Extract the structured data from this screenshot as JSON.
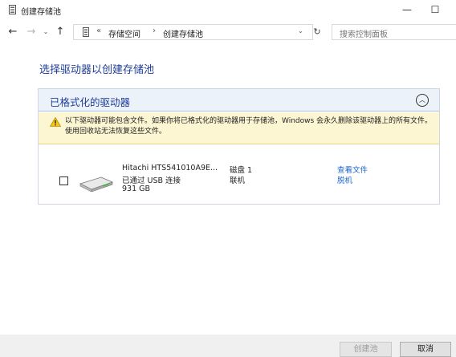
{
  "window": {
    "title": "创建存储池",
    "minimize_label": "—",
    "maximize_label": "☐"
  },
  "address": {
    "overflow": "«",
    "crumbs": [
      "存储空间",
      "创建存储池"
    ],
    "separator": "›",
    "search_placeholder": "搜索控制面板"
  },
  "main": {
    "heading": "选择驱动器以创建存储池",
    "panel_title": "已格式化的驱动器",
    "warning_text": "以下驱动器可能包含文件。如果你将已格式化的驱动器用于存储池，Windows 会永久删除该驱动器上的所有文件。使用回收站无法恢复这些文件。",
    "drives": [
      {
        "name": "Hitachi HTS541010A9E...",
        "connection": "已通过 USB 连接",
        "size": "931 GB",
        "disk": "磁盘 1",
        "state": "联机",
        "link_view": "查看文件",
        "link_offline": "脱机",
        "checked": false
      }
    ]
  },
  "footer": {
    "create_label": "创建池",
    "cancel_label": "取消"
  },
  "colors": {
    "heading": "#1f3d99",
    "link": "#1a66cc",
    "warning_bg": "#fdf6d3",
    "panel_header_bg": "#ecf2fa"
  }
}
